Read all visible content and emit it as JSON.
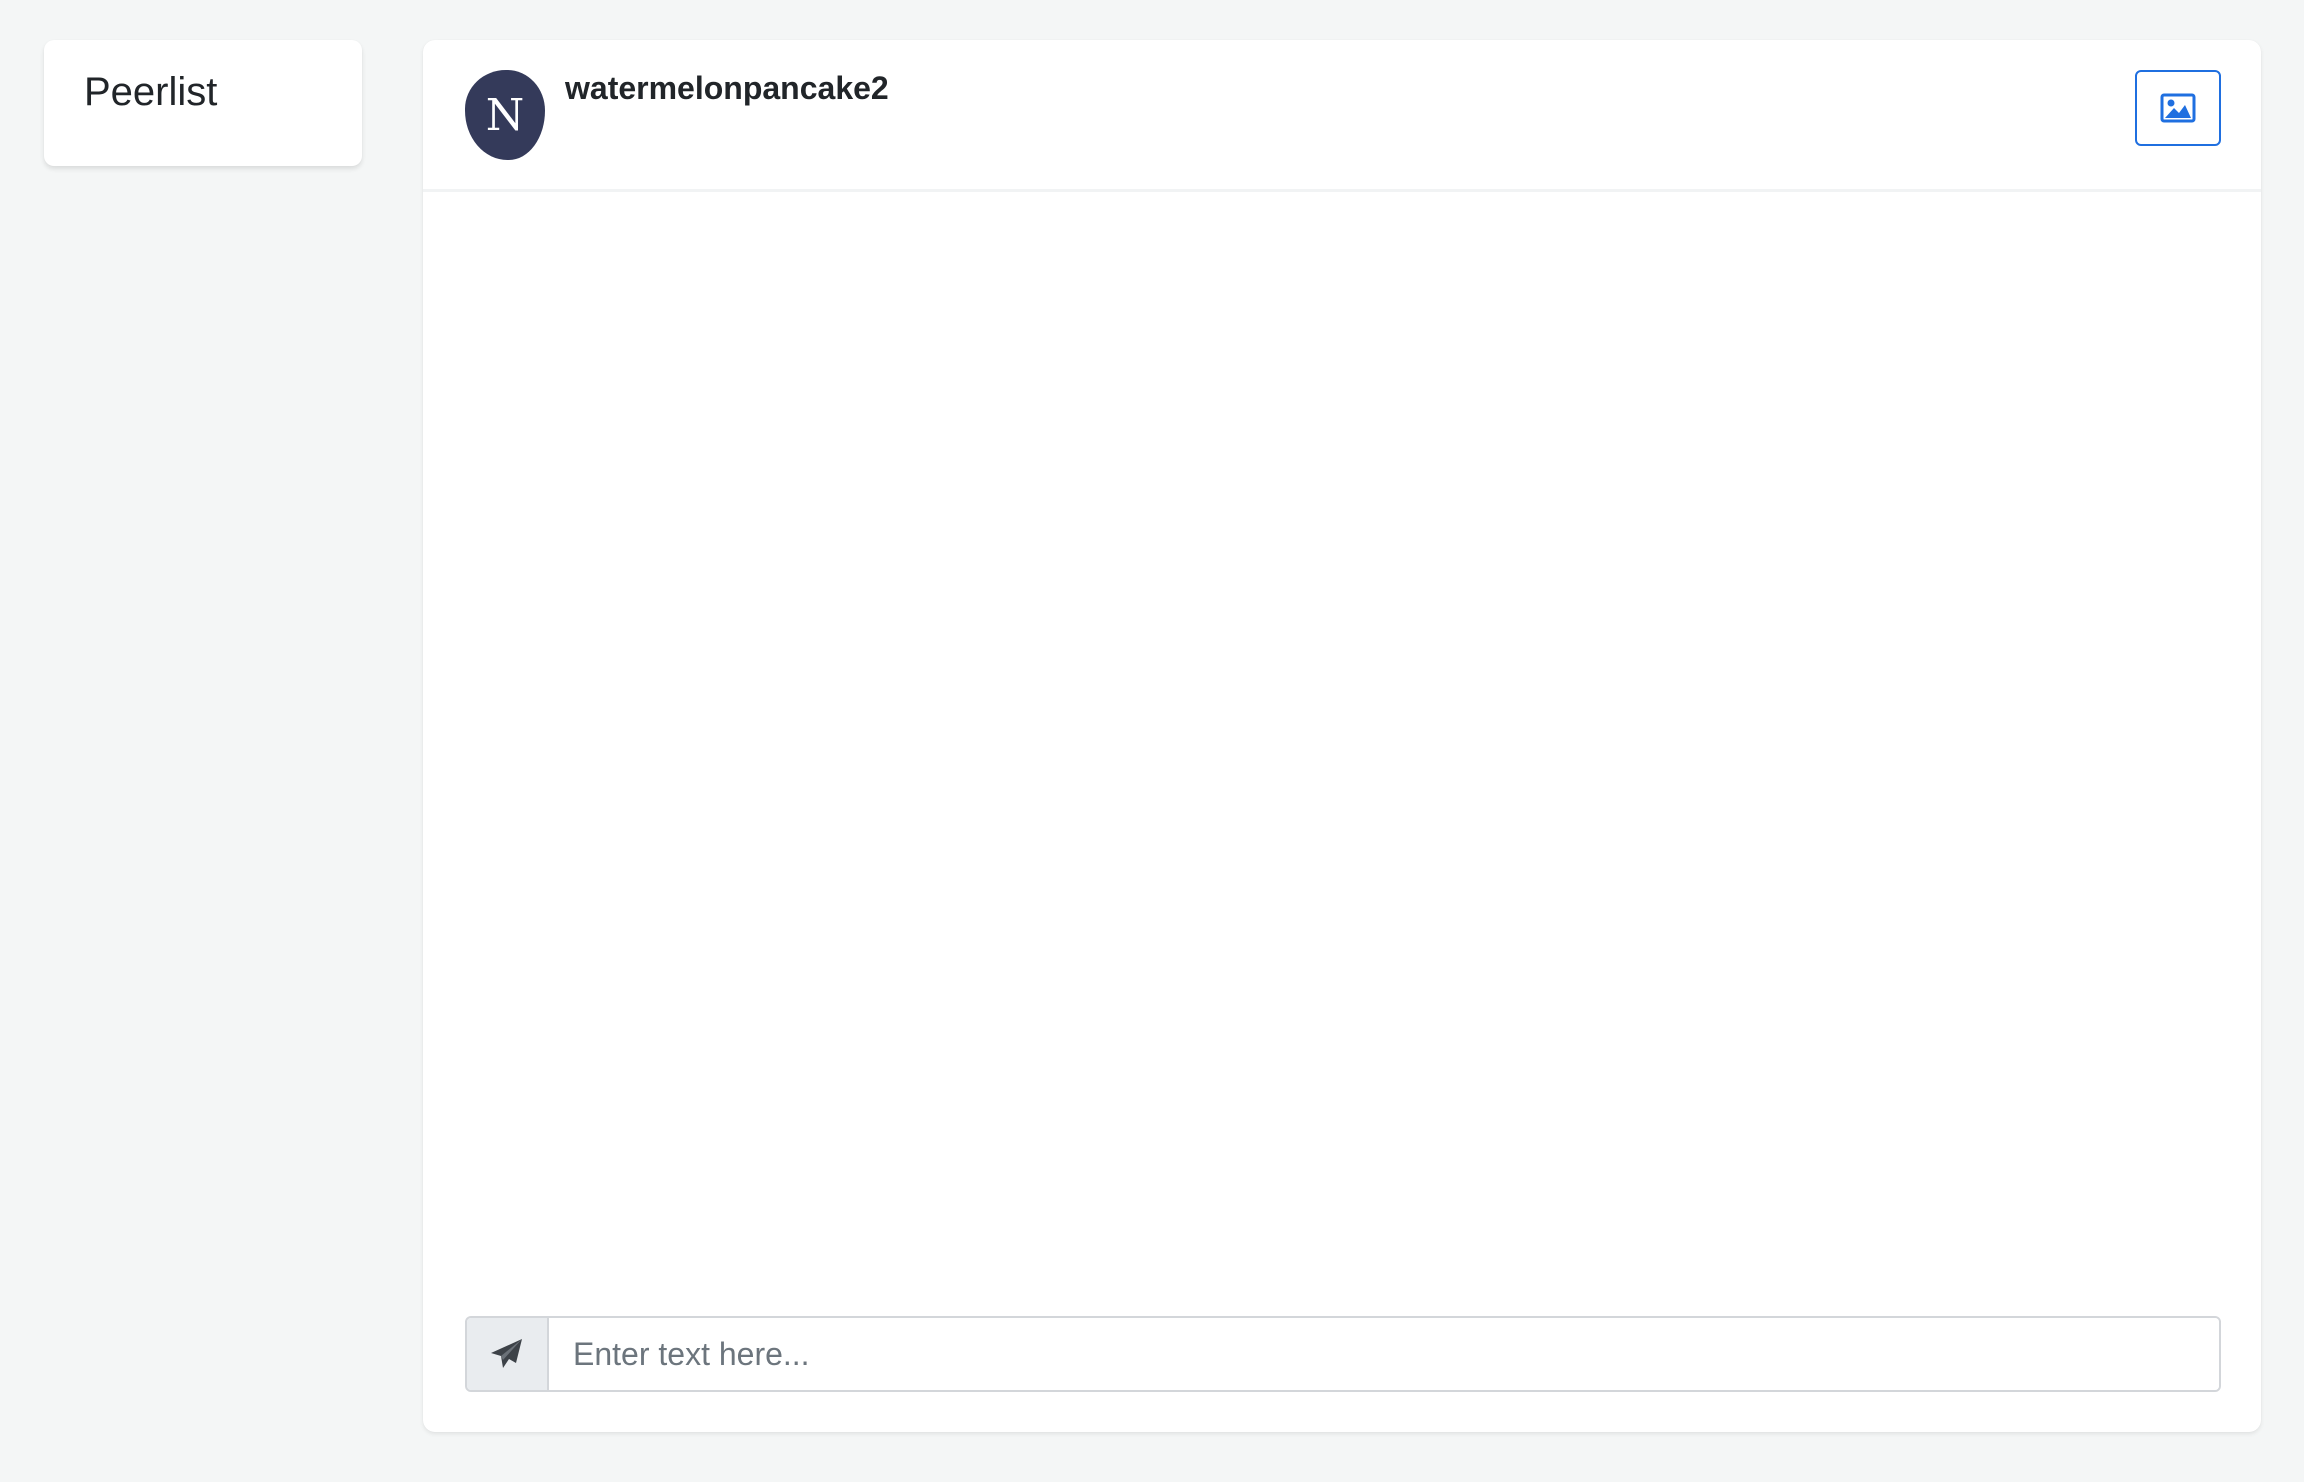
{
  "sidebar": {
    "title": "Peerlist"
  },
  "chat": {
    "avatar_initial": "N",
    "username": "watermelonpancake2",
    "image_button_icon": "image-icon",
    "send_button_icon": "paper-plane-icon",
    "input": {
      "value": "",
      "placeholder": "Enter text here..."
    }
  },
  "colors": {
    "page_background": "#f4f6f6",
    "card_background": "#ffffff",
    "avatar_background": "#343a5a",
    "accent": "#1f6fe0",
    "send_button_background": "#e9ecef"
  }
}
